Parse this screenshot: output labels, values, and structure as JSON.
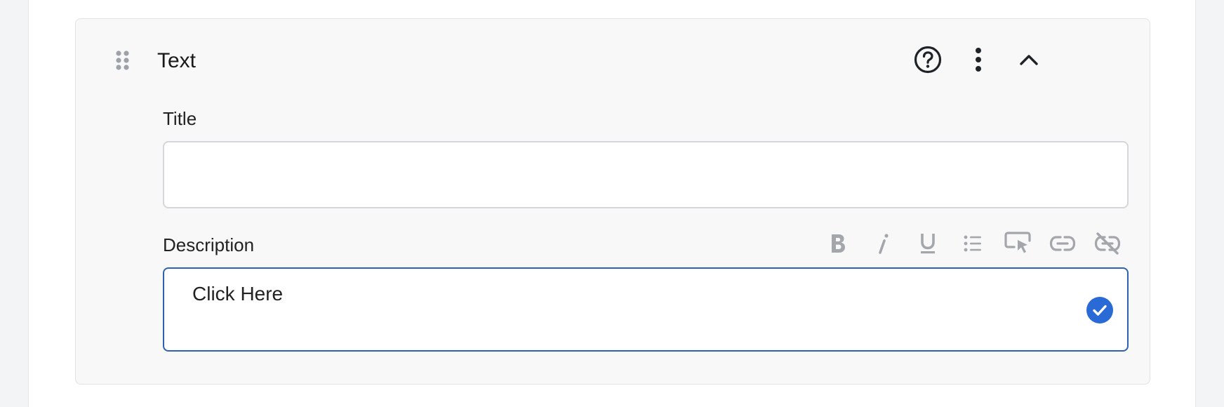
{
  "block": {
    "title": "Text",
    "icons": {
      "drag": "drag-handle-icon",
      "help": "help-circle-icon",
      "more": "more-vertical-icon",
      "collapse": "chevron-up-icon"
    }
  },
  "title_field": {
    "label": "Title",
    "value": "",
    "placeholder": ""
  },
  "description_field": {
    "label": "Description",
    "value": "Click Here",
    "toolbar": [
      "bold-icon",
      "italic-icon",
      "underline-icon",
      "bullet-list-icon",
      "cta-button-icon",
      "link-icon",
      "unlink-icon"
    ],
    "status_icon": "check-circle-icon"
  },
  "colors": {
    "accent": "#2a6ad6",
    "focus_border": "#2d62b3",
    "toolbar_icon": "#a3a6ab"
  }
}
